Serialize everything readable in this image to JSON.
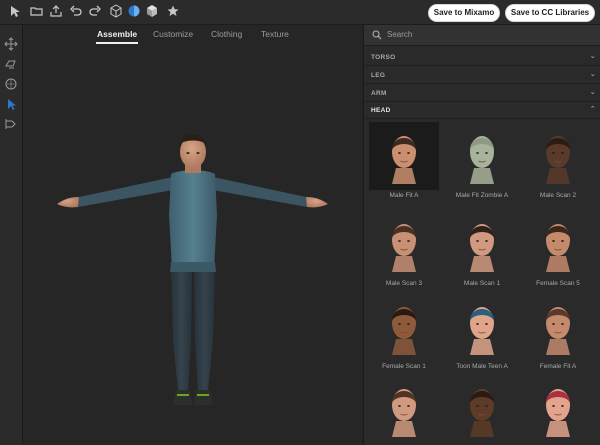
{
  "topbar": {
    "tools": [
      {
        "icon": "select-arrow-icon"
      },
      {
        "icon": "open-folder-icon"
      },
      {
        "icon": "export-icon"
      },
      {
        "icon": "undo-icon"
      },
      {
        "icon": "redo-icon"
      },
      {
        "icon": "cube-outline-icon"
      },
      {
        "icon": "sphere-icon"
      },
      {
        "icon": "cube-solid-icon"
      },
      {
        "icon": "star-icon"
      }
    ],
    "save_mixamo": "Save to Mixamo",
    "save_cc": "Save to CC Libraries"
  },
  "leftbar": {
    "tools": [
      {
        "icon": "move-icon"
      },
      {
        "icon": "rotate-icon"
      },
      {
        "icon": "orbit-icon"
      },
      {
        "icon": "pointer-icon"
      },
      {
        "icon": "split-icon"
      }
    ],
    "active_index": 3
  },
  "viewport": {
    "tabs": [
      {
        "label": "Assemble"
      },
      {
        "label": "Customize"
      },
      {
        "label": "Clothing"
      },
      {
        "label": "Texture"
      }
    ],
    "active_tab": "Assemble"
  },
  "panel": {
    "search_placeholder": "Search",
    "sections": [
      {
        "label": "TORSO",
        "open": false
      },
      {
        "label": "LEG",
        "open": false
      },
      {
        "label": "ARM",
        "open": false
      },
      {
        "label": "HEAD",
        "open": true
      }
    ],
    "heads": [
      {
        "label": "Male Fit A",
        "skin": "#c98f6e",
        "hair": "#3a2a1f",
        "selected": true
      },
      {
        "label": "Male Fit Zombie A",
        "skin": "#a7b39a",
        "hair": "#8e9a82",
        "selected": false
      },
      {
        "label": "Male Scan 2",
        "skin": "#5a3a2a",
        "hair": "#2a1c14",
        "selected": false
      },
      {
        "label": "Male Scan 3",
        "skin": "#c89075",
        "hair": "#4a3021",
        "selected": false
      },
      {
        "label": "Male Scan 1",
        "skin": "#d09a80",
        "hair": "#2e221b",
        "selected": false
      },
      {
        "label": "Female Scan 5",
        "skin": "#c48a6c",
        "hair": "#3b271c",
        "selected": false
      },
      {
        "label": "Female Scan 1",
        "skin": "#8e5a3c",
        "hair": "#2b1a12",
        "selected": false
      },
      {
        "label": "Toon Male Teen A",
        "skin": "#e0a48a",
        "hair": "#2b5f7e",
        "selected": false
      },
      {
        "label": "Female Fit A",
        "skin": "#c48a6e",
        "hair": "#5a3a2a",
        "selected": false
      },
      {
        "label": "",
        "skin": "#d09a80",
        "hair": "#4e3424",
        "selected": false
      },
      {
        "label": "",
        "skin": "#5e3b27",
        "hair": "#2a1a12",
        "selected": false
      },
      {
        "label": "",
        "skin": "#e2a48c",
        "hair": "#a83240",
        "selected": false
      }
    ]
  },
  "colors": {
    "accent_blue": "#2d78c8",
    "shirt": "#4b6f7f",
    "leggings": "#2f3b44",
    "shoe_accent": "#6fa02a"
  }
}
